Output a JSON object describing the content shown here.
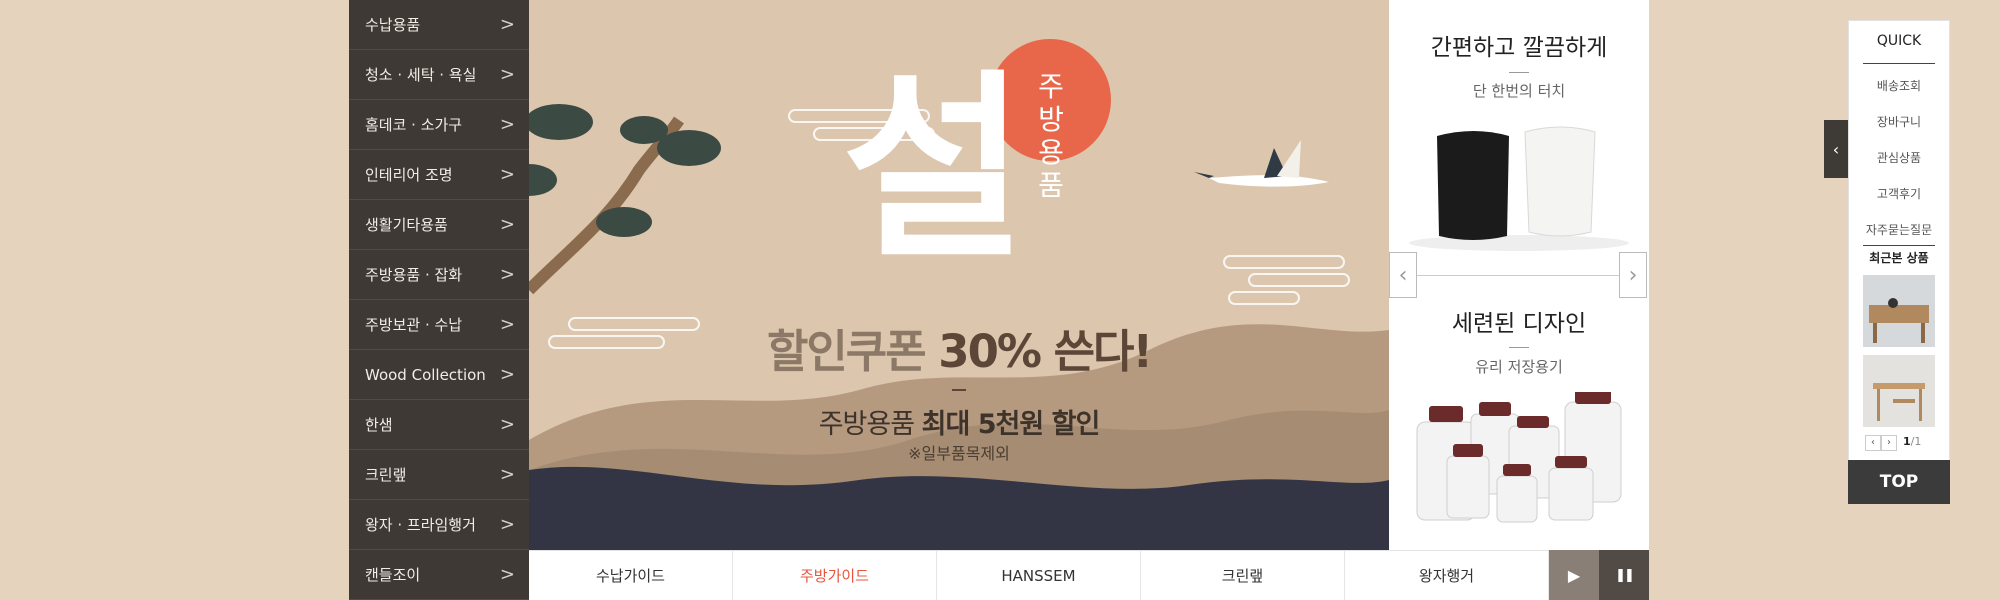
{
  "sidebar": {
    "items": [
      {
        "label": "수납용품"
      },
      {
        "label": "청소 · 세탁 · 욕실"
      },
      {
        "label": "홈데코 · 소가구"
      },
      {
        "label": "인테리어 조명"
      },
      {
        "label": "생활기타용품"
      },
      {
        "label": "주방용품 · 잡화"
      },
      {
        "label": "주방보관 · 수납"
      },
      {
        "label": "Wood Collection"
      },
      {
        "label": "한샘"
      },
      {
        "label": "크린랲"
      },
      {
        "label": "왕자 · 프라임행거"
      },
      {
        "label": "캔들조이"
      }
    ],
    "chevron": ">"
  },
  "hero": {
    "big_char": "설",
    "badge_text": "주방용품",
    "headline_prefix": "할인쿠폰",
    "headline_highlight": "30% 쓴다!",
    "sub_prefix": "주방용품",
    "sub_highlight": "최대 5천원 할인",
    "note": "※일부품목제외",
    "sun_color": "#e8674a"
  },
  "tabs": {
    "items": [
      {
        "label": "수납가이드",
        "active": false
      },
      {
        "label": "주방가이드",
        "active": true
      },
      {
        "label": "HANSSEM",
        "active": false
      },
      {
        "label": "크린랲",
        "active": false
      },
      {
        "label": "왕자행거",
        "active": false
      }
    ],
    "play_icon": "▶",
    "pause_icon": "❚❚"
  },
  "promo": {
    "top": {
      "title": "간편하고 깔끔하게",
      "subtitle": "단 한번의 터치"
    },
    "bottom": {
      "title": "세련된 디자인",
      "subtitle": "유리 저장용기"
    },
    "prev_icon": "‹",
    "next_icon": "›"
  },
  "quick": {
    "title": "QUICK",
    "links": [
      "배송조회",
      "장바구니",
      "관심상품",
      "고객후기",
      "자주묻는질문"
    ],
    "recent_title": "최근본 상품",
    "page_current": "1",
    "page_total": "1",
    "page_sep": "/",
    "top_label": "TOP",
    "toggle_icon": "‹"
  },
  "colors": {
    "accent": "#e8553e",
    "sidebar_bg": "#3e3934",
    "page_bg": "#e6d3bd"
  }
}
